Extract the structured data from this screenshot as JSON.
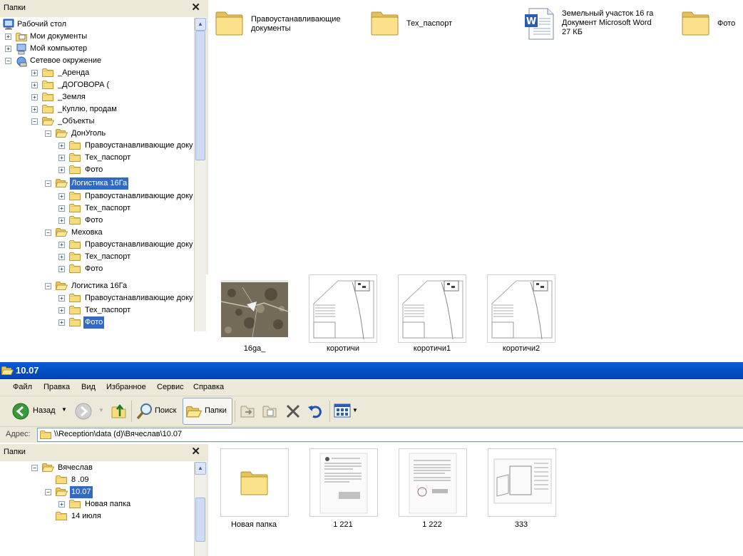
{
  "top_window": {
    "folders_pane": {
      "title": "Папки",
      "tree": [
        {
          "label": "Рабочий стол",
          "icon": "desktop-icon"
        },
        {
          "label": "Мои документы",
          "icon": "my-documents-icon"
        },
        {
          "label": "Мой компьютер",
          "icon": "my-computer-icon"
        },
        {
          "label": "Сетевое окружение",
          "icon": "network-icon"
        },
        {
          "label": "_Аренда"
        },
        {
          "label": "_ДОГОВОРА ("
        },
        {
          "label": "_Земля"
        },
        {
          "label": "_Куплю, продам"
        },
        {
          "label": "_Объекты"
        },
        {
          "label": "ДонУголь"
        },
        {
          "label": "Правоустанавливающие доку"
        },
        {
          "label": "Тех_паспорт"
        },
        {
          "label": "Фото"
        },
        {
          "label": "Логистика 16Га"
        },
        {
          "label": "Правоустанавливающие доку"
        },
        {
          "label": "Тех_паспорт"
        },
        {
          "label": "Фото"
        },
        {
          "label": "Меховка"
        },
        {
          "label": "Правоустанавливающие доку"
        },
        {
          "label": "Тех_паспорт"
        },
        {
          "label": "Фото"
        },
        {
          "label": "Логистика 16Га"
        },
        {
          "label": "Правоустанавливающие доку"
        },
        {
          "label": "Тех_паспорт"
        },
        {
          "label": "Фото"
        }
      ]
    },
    "content": {
      "items": [
        {
          "line1": "Правоустанавливающие",
          "line2": "документы",
          "icon": "folder-icon"
        },
        {
          "line1": "Тех_паспорт",
          "icon": "folder-icon"
        },
        {
          "line1": "Земельный участок 16 га",
          "line2": "Документ Microsoft Word",
          "line3": "27 КБ",
          "icon": "word-document-icon"
        },
        {
          "line1": "Фото",
          "icon": "folder-icon"
        }
      ]
    },
    "thumbnails": [
      {
        "label": "16ga_"
      },
      {
        "label": "коротичи"
      },
      {
        "label": "коротичи1"
      },
      {
        "label": "коротичи2"
      }
    ]
  },
  "bottom_window": {
    "title": "10.07",
    "menu": [
      "Файл",
      "Правка",
      "Вид",
      "Избранное",
      "Сервис",
      "Справка"
    ],
    "toolbar": {
      "back_label": "Назад",
      "search_label": "Поиск",
      "folders_label": "Папки"
    },
    "address": {
      "label": "Адрес:",
      "value": "\\\\Reception\\data (d)\\Вячеслав\\10.07"
    },
    "folders_pane": {
      "title": "Папки",
      "tree": [
        {
          "label": "Вячеслав"
        },
        {
          "label": "8 .09"
        },
        {
          "label": "10.07"
        },
        {
          "label": "Новая папка"
        },
        {
          "label": "14 июля"
        }
      ]
    },
    "thumbnails": [
      {
        "label": "Новая папка"
      },
      {
        "label": "1 221"
      },
      {
        "label": "1 222"
      },
      {
        "label": "333"
      }
    ]
  },
  "colors": {
    "selection": "#316ac5",
    "titlebar": "#0550c8",
    "chrome": "#ece9d8",
    "folder": "#f6dc7c"
  }
}
